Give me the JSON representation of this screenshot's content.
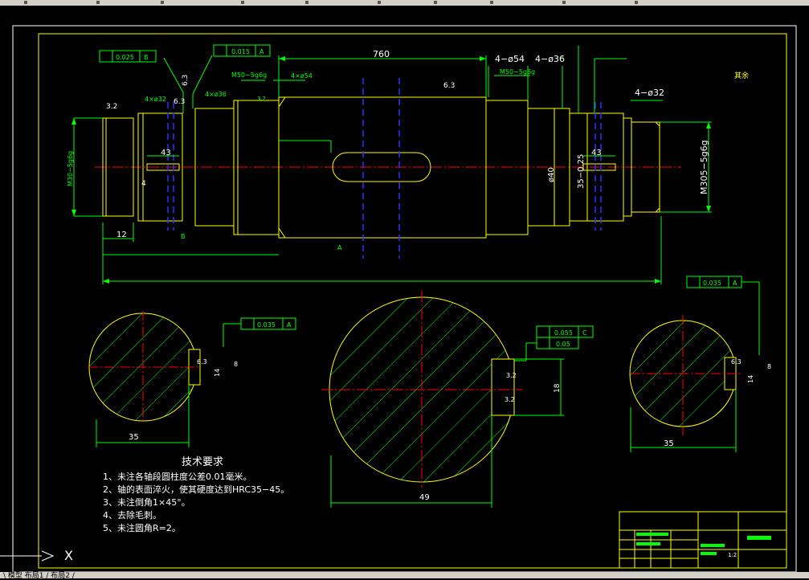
{
  "drawing": {
    "dims": {
      "overall_length": "760",
      "dia_4x54": "4−ø54",
      "dia_4x36": "4−ø36",
      "dia_4x32": "4−ø32",
      "thread_left": "M30−5g6g",
      "thread_right": "M305−5g6g",
      "thread_m50_left": "M50−5g6g",
      "thread_m50_right": "M50−5g6g",
      "dia_40": "ø40",
      "dim_12": "12",
      "dim_43_left": "43",
      "dim_43_right": "43",
      "dim_4": "4",
      "dim_35_right_shaft": "35−0.25",
      "dim_4x32_small": "4×ø32",
      "dim_4x36_small": "4×ø36",
      "dim_4x54_small": "4×ø54",
      "dim_49": "49",
      "dim_18": "18",
      "dim_35_left_section": "35",
      "dim_35_right_section": "35",
      "dim_14_left": "14",
      "dim_14_right": "14",
      "dim_8_left": "8",
      "dim_8_right": "8"
    },
    "roughness": {
      "r32_a": "3.2",
      "r63_a": "6.3",
      "r63_b": "6.3",
      "r63_mid": "6.3",
      "r32_b": "3.2",
      "r32_sec_a": "3.2",
      "r32_sec_b": "3.2",
      "r63_sec_a": "6.3",
      "r63_sec_b": "6.3",
      "rest": "其余"
    },
    "tolerances": {
      "fcf_1": "0.025",
      "fcf_1_datum": "B",
      "fcf_2": "0.015",
      "fcf_2_datum": "A",
      "fcf_left_section": "0.035",
      "fcf_left_section_datum": "A",
      "fcf_mid_1": "0.055",
      "fcf_mid_1_datum": "C",
      "fcf_mid_2": "0.05",
      "fcf_right_section": "0.035",
      "fcf_right_section_datum": "A"
    },
    "datums": {
      "b": "B",
      "a": "A"
    },
    "notes": {
      "title": "技术要求",
      "items": [
        "1、未注各轴段圆柱度公差0.01毫米。",
        "2、轴的表面淬火，使其硬度达到HRC35−45。",
        "3、未注倒角1×45°。",
        "4、去除毛刺。",
        "5、未注圆角R=2。"
      ]
    },
    "title_block": {
      "scale": "1:2"
    }
  },
  "ucs": {
    "label": "X"
  },
  "status": {
    "text": "\\ 模型  布局1 / 布局2 /"
  },
  "colors": {
    "background": "#000000",
    "geometry": "#ffff00",
    "dimensions": "#00ff00",
    "centerline": "#ff0000",
    "hatch": "#00ff00",
    "hidden": "#0000ff"
  }
}
